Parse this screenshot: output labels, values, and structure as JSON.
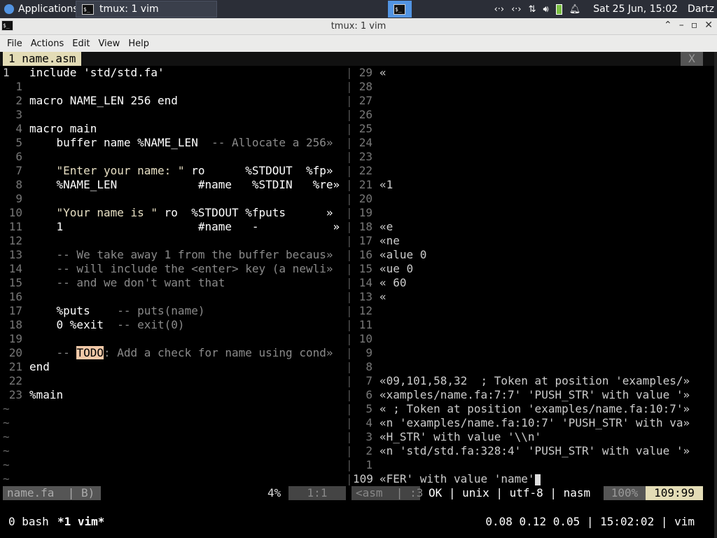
{
  "panel": {
    "applications_label": "Applications",
    "task_label": "tmux: 1 vim",
    "datetime": "Sat 25 Jun, 15:02",
    "user": "Dartz"
  },
  "window": {
    "title": "tmux: 1 vim"
  },
  "menu": [
    "File",
    "Actions",
    "Edit",
    "View",
    "Help"
  ],
  "vim": {
    "tab_label": "1 name.asm",
    "tab_close": "X",
    "left_lines": [
      {
        "n": "1",
        "cur": true,
        "t": "include 'std/std.fa'"
      },
      {
        "n": "1",
        "t": ""
      },
      {
        "n": "2",
        "t": "macro NAME_LEN 256 end"
      },
      {
        "n": "3",
        "t": ""
      },
      {
        "n": "4",
        "t": "macro main"
      },
      {
        "n": "5",
        "t": "    buffer name %NAME_LEN  -- Allocate a 256»"
      },
      {
        "n": "6",
        "t": ""
      },
      {
        "n": "7",
        "t": "    \"Enter your name: \" ro      %STDOUT  %fp»"
      },
      {
        "n": "8",
        "t": "    %NAME_LEN            #name   %STDIN   %re»"
      },
      {
        "n": "9",
        "t": ""
      },
      {
        "n": "10",
        "t": "    \"Your name is \" ro  %STDOUT %fputs      »"
      },
      {
        "n": "11",
        "t": "    1                    #name   -           »"
      },
      {
        "n": "12",
        "t": ""
      },
      {
        "n": "13",
        "t": "    -- We take away 1 from the buffer becaus»"
      },
      {
        "n": "14",
        "t": "    -- will include the <enter> key (a newli»"
      },
      {
        "n": "15",
        "t": "    -- and we don't want that"
      },
      {
        "n": "16",
        "t": ""
      },
      {
        "n": "17",
        "t": "    %puts    -- puts(name)"
      },
      {
        "n": "18",
        "t": "    0 %exit  -- exit(0)"
      },
      {
        "n": "19",
        "t": ""
      },
      {
        "n": "20",
        "t": "    -- TODO: Add a check for name using cond»"
      },
      {
        "n": "21",
        "t": "end"
      },
      {
        "n": "22",
        "t": ""
      },
      {
        "n": "23",
        "t": "%main"
      },
      {
        "n": "~",
        "t": ""
      },
      {
        "n": "~",
        "t": ""
      },
      {
        "n": "~",
        "t": ""
      },
      {
        "n": "~",
        "t": ""
      },
      {
        "n": "~",
        "t": ""
      },
      {
        "n": "~",
        "t": ""
      }
    ],
    "right_lines": [
      {
        "n": "29",
        "t": "«"
      },
      {
        "n": "28",
        "t": ""
      },
      {
        "n": "27",
        "t": ""
      },
      {
        "n": "26",
        "t": ""
      },
      {
        "n": "25",
        "t": ""
      },
      {
        "n": "24",
        "t": ""
      },
      {
        "n": "23",
        "t": ""
      },
      {
        "n": "22",
        "t": ""
      },
      {
        "n": "21",
        "t": "«1"
      },
      {
        "n": "20",
        "t": ""
      },
      {
        "n": "19",
        "t": ""
      },
      {
        "n": "18",
        "t": "«e"
      },
      {
        "n": "17",
        "t": "«ne"
      },
      {
        "n": "16",
        "t": "«alue 0"
      },
      {
        "n": "15",
        "t": "«ue 0"
      },
      {
        "n": "14",
        "t": "« 60"
      },
      {
        "n": "13",
        "t": "«"
      },
      {
        "n": "12",
        "t": ""
      },
      {
        "n": "11",
        "t": ""
      },
      {
        "n": "10",
        "t": ""
      },
      {
        "n": "9",
        "t": ""
      },
      {
        "n": "8",
        "t": ""
      },
      {
        "n": "7",
        "t": "«09,101,58,32  ; Token at position 'examples/»"
      },
      {
        "n": "6",
        "t": "«xamples/name.fa:7:7' 'PUSH_STR' with value '»"
      },
      {
        "n": "5",
        "t": "« ; Token at position 'examples/name.fa:10:7'»"
      },
      {
        "n": "4",
        "t": "«n 'examples/name.fa:10:7' 'PUSH_STR' with va»"
      },
      {
        "n": "3",
        "t": "«H_STR' with value '\\\\n'"
      },
      {
        "n": "2",
        "t": "«n 'std/std.fa:328:4' 'PUSH_STR' with value '»"
      },
      {
        "n": "1",
        "t": ""
      },
      {
        "n": "109",
        "cur": true,
        "t": "«FER' with value 'name'"
      }
    ],
    "status": {
      "left_file": "name.fa  | B)",
      "left_pct": "4%",
      "left_pos": "1:1",
      "right_file": "<asm  | :3",
      "right_info": "OK | unix | utf-8 | nasm",
      "right_pct": "100%",
      "right_pos": "109:99"
    }
  },
  "tmux": {
    "win0": "0 bash",
    "win1": "*1 vim*",
    "right": "0.08 0.12 0.05 | 15:02:02 | vim"
  },
  "colors": {
    "tab_active": "#e3dcb6",
    "todo_highlight": "#f2c9a8",
    "status_pos": "#e3dcb6"
  }
}
